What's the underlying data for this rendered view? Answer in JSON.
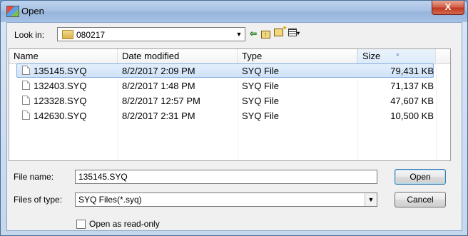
{
  "window": {
    "title": "Open",
    "close_glyph": "X"
  },
  "toolbar": {
    "look_in_label": "Look in:",
    "look_in_value": "080217",
    "dropdown_glyph": "▼",
    "back_glyph": "⇦",
    "up_glyph": "↑",
    "views_glyph": "▾"
  },
  "file_list": {
    "columns": {
      "name": "Name",
      "date_modified": "Date modified",
      "type": "Type",
      "size": "Size"
    },
    "rows": [
      {
        "name": "135145.SYQ",
        "date": "8/2/2017 2:09 PM",
        "type": "SYQ File",
        "size": "79,431 KB",
        "selected": true
      },
      {
        "name": "132403.SYQ",
        "date": "8/2/2017 1:48 PM",
        "type": "SYQ File",
        "size": "71,137 KB",
        "selected": false
      },
      {
        "name": "123328.SYQ",
        "date": "8/2/2017 12:57 PM",
        "type": "SYQ File",
        "size": "47,607 KB",
        "selected": false
      },
      {
        "name": "142630.SYQ",
        "date": "8/2/2017 2:31 PM",
        "type": "SYQ File",
        "size": "10,500 KB",
        "selected": false
      }
    ]
  },
  "form": {
    "file_name_label": "File name:",
    "file_name_value": "135145.SYQ",
    "files_of_type_label": "Files of type:",
    "files_of_type_value": "SYQ Files(*.syq)",
    "read_only_label": "Open as read-only",
    "read_only_checked": false
  },
  "buttons": {
    "open": "Open",
    "cancel": "Cancel"
  },
  "icons": [
    "app-icon",
    "close-icon",
    "folder-icon",
    "back-icon",
    "up-folder-icon",
    "new-folder-icon",
    "views-menu-icon",
    "file-icon",
    "sort-arrow-icon"
  ]
}
